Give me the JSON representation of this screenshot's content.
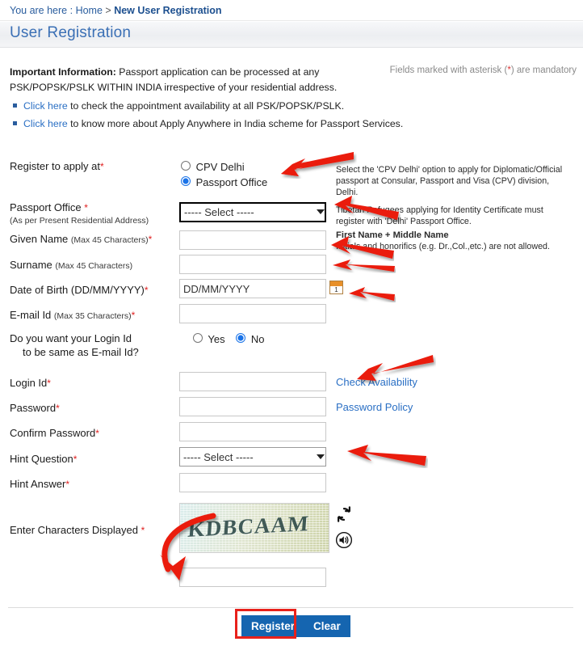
{
  "breadcrumb": {
    "prefix": "You are here :",
    "home": "Home",
    "separator": ">",
    "current": "New User Registration"
  },
  "page": {
    "title": "User Registration"
  },
  "info": {
    "heading": "Important Information:",
    "body": " Passport application can be processed at any PSK/POPSK/PSLK WITHIN INDIA irrespective of your residential address.",
    "mandatory_note_pre": "Fields marked with asterisk (",
    "mandatory_note_ast": "*",
    "mandatory_note_post": ") are mandatory",
    "bullets": [
      {
        "link": "Click here",
        "text": " to check the appointment availability at all PSK/POPSK/PSLK."
      },
      {
        "link": "Click here",
        "text": " to know more about Apply Anywhere in India scheme for Passport Services."
      }
    ]
  },
  "form": {
    "register_to_apply_at": {
      "label": "Register to apply at",
      "asterisk": "*",
      "options": [
        "CPV Delhi",
        "Passport Office"
      ],
      "selected": "Passport Office",
      "help": "Select the 'CPV Delhi' option to apply for Diplomatic/Official passport at Consular, Passport and Visa (CPV) division, Delhi."
    },
    "passport_office": {
      "label": "Passport Office",
      "asterisk": "*",
      "sublabel": "(As per Present Residential Address)",
      "value": "----- Select -----",
      "options": [
        "----- Select -----"
      ],
      "help": "Tibetan Refugees applying for Identity Certificate must register with 'Delhi' Passport Office."
    },
    "given_name": {
      "label": "Given Name",
      "sublabel": "(Max 45 Characters)",
      "asterisk": "*",
      "value": "",
      "help_title": "First Name + Middle Name",
      "help": "Initials and honorifics (e.g. Dr.,Col.,etc.) are not allowed."
    },
    "surname": {
      "label": "Surname",
      "sublabel": "(Max 45 Characters)",
      "asterisk": "",
      "value": ""
    },
    "date_of_birth": {
      "label": "Date of Birth (DD/MM/YYYY)",
      "asterisk": "*",
      "value": "DD/MM/YYYY",
      "calendar_day": "1"
    },
    "email_id": {
      "label": "E-mail Id",
      "sublabel": "(Max 35 Characters)",
      "asterisk": "*",
      "value": ""
    },
    "login_same_as_email": {
      "label_line1": "Do you want your Login Id",
      "label_line2": "to be same as E-mail Id?",
      "options": [
        "Yes",
        "No"
      ],
      "selected": "No"
    },
    "login_id": {
      "label": "Login Id",
      "asterisk": "*",
      "value": "",
      "action_link": "Check Availability"
    },
    "password": {
      "label": "Password",
      "asterisk": "*",
      "value": "",
      "action_link": "Password Policy"
    },
    "confirm_password": {
      "label": "Confirm Password",
      "asterisk": "*",
      "value": ""
    },
    "hint_question": {
      "label": "Hint Question",
      "asterisk": "*",
      "value": "----- Select -----",
      "options": [
        "----- Select -----"
      ]
    },
    "hint_answer": {
      "label": "Hint Answer",
      "asterisk": "*",
      "value": ""
    },
    "captcha": {
      "label": "Enter Characters Displayed",
      "asterisk": "*",
      "image_text": "KDBCAAM",
      "value": "",
      "refresh_icon": "refresh-icon",
      "audio_icon": "speaker-icon"
    }
  },
  "actions": {
    "register": "Register",
    "clear": "Clear"
  },
  "colors": {
    "link": "#2a6fc4",
    "title": "#3a6fb5",
    "asterisk": "#e02020",
    "button": "#1565b0",
    "highlight": "#e8211b"
  }
}
